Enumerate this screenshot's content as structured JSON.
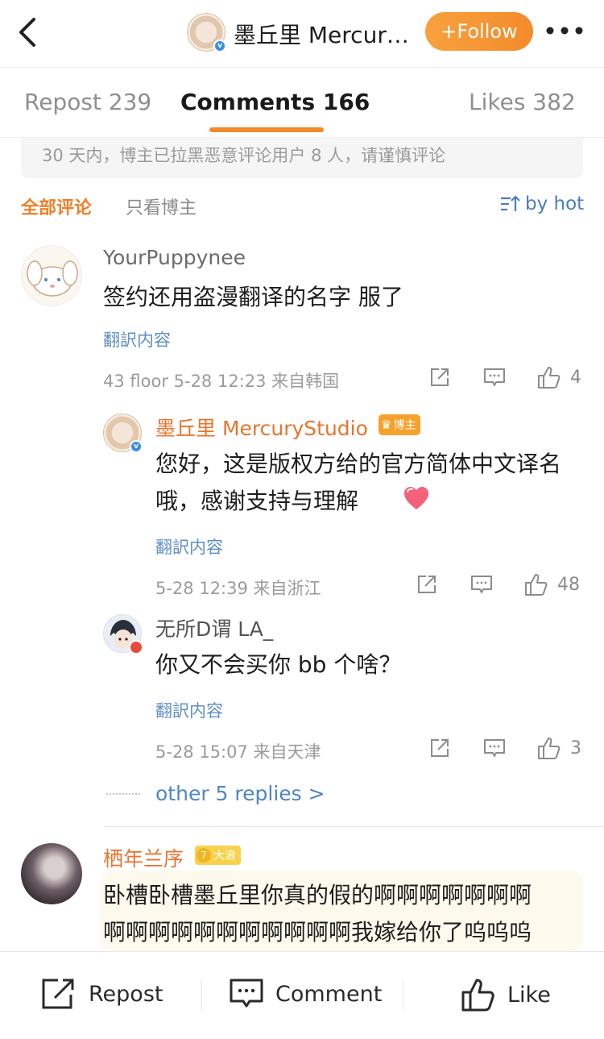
{
  "header": {
    "title": "墨丘里 MercuryStudio",
    "follow_label": "+Follow",
    "icons": {
      "back": "chevron-left-icon",
      "more": "more-dots-icon"
    }
  },
  "tabs": [
    {
      "label": "Repost 239",
      "active": false
    },
    {
      "label": "Comments 166",
      "active": true
    },
    {
      "label": "Likes 382",
      "active": false
    }
  ],
  "notice": "30 天内，博主已拉黑恶意评论用户 8 人，请谨慎评论",
  "filter": {
    "all": "全部评论",
    "owner_only": "只看博主",
    "sort": "by hot"
  },
  "colors": {
    "accent": "#f58a2d",
    "link": "#4e86c2",
    "owner_name": "#e9742c"
  },
  "comments": [
    {
      "username": "YourPuppynee",
      "text": "签约还用盗漫翻译的名字 服了",
      "translate": "翻訳内容",
      "meta": "43 floor 5-28 12:23 来自韩国",
      "likes": "4",
      "replies": [
        {
          "username": "墨丘里 MercuryStudio",
          "badge": "博主",
          "text": "您好，这是版权方给的官方简体中文译名哦，感谢支持与理解",
          "translate": "翻訳内容",
          "meta": "5-28 12:39 来自浙江",
          "likes": "48"
        },
        {
          "username": "无所D谓 LA_",
          "text": "你又不会买你 bb 个啥？",
          "translate": "翻訳内容",
          "meta": "5-28 15:07 来自天津",
          "likes": "3"
        }
      ],
      "more_replies": "other 5 replies >"
    },
    {
      "username": "栖年兰序",
      "level": "7",
      "level_badge": "大浪",
      "text_line1": "卧槽卧槽墨丘里你真的假的啊啊啊啊啊啊啊",
      "text_line2": "啊啊啊啊啊啊啊啊啊啊啊我嫁给你了呜呜呜"
    }
  ],
  "bottom": {
    "repost": "Repost",
    "comment": "Comment",
    "like": "Like"
  }
}
